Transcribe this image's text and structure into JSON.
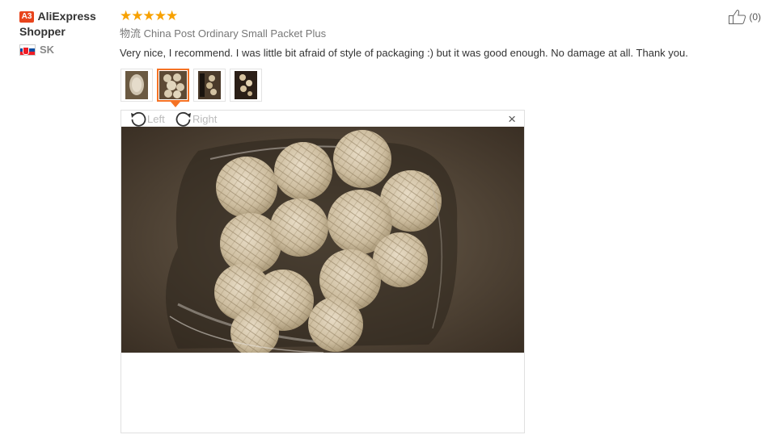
{
  "reviewer": {
    "level": "A3",
    "name": "AliExpress Shopper",
    "country": "SK"
  },
  "review": {
    "rating": 5,
    "stars": "★★★★★",
    "logistics_label": "物流",
    "logistics_value": "China Post Ordinary Small Packet Plus",
    "text": "Very nice, I recommend. I was little bit afraid of style of packaging :) but it was good enough. No damage at all. Thank you."
  },
  "thumbnails": [
    {
      "name": "photo-1",
      "active": false
    },
    {
      "name": "photo-2",
      "active": true
    },
    {
      "name": "photo-3",
      "active": false
    },
    {
      "name": "photo-4",
      "active": false
    }
  ],
  "viewer": {
    "rotate_left": "Left",
    "rotate_right": "Right",
    "close": "×"
  },
  "helpful": {
    "count": "(0)"
  },
  "colors": {
    "accent": "#f57224",
    "star": "#f7a100",
    "level_badge": "#e8441c"
  }
}
